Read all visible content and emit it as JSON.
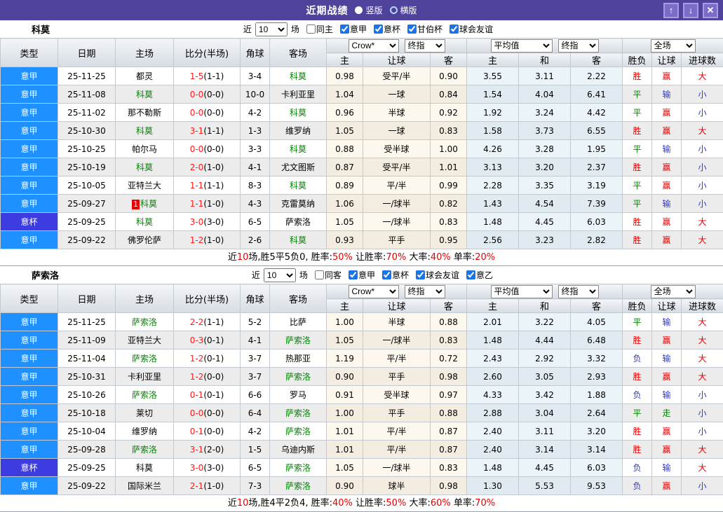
{
  "titlebar": {
    "title": "近期战绩",
    "radios": [
      {
        "label": "竖版",
        "selected": true
      },
      {
        "label": "横版",
        "selected": false
      }
    ],
    "icons": {
      "up": "↑",
      "down": "↓",
      "close": "✕"
    }
  },
  "colors": {
    "title_bg": "#4f429b",
    "league_serie_a_bg": "#1e90ff",
    "league_cup_bg": "#3c3ce0",
    "team_highlight": "#008800",
    "score_red": "#ff1a1a",
    "win_red": "#e60000",
    "lose_blue": "#2b36cc",
    "draw_green": "#008800"
  },
  "table_header": {
    "left": [
      "类型",
      "日期",
      "主场",
      "比分(半场)",
      "角球",
      "客场"
    ],
    "sub": [
      "主",
      "让球",
      "客",
      "主",
      "和",
      "客",
      "胜负",
      "让球",
      "进球数"
    ],
    "dropdowns": {
      "asian_source": "Crow*",
      "asian_time": "终指",
      "euro_source": "平均值",
      "euro_time": "终指",
      "scope": "全场"
    }
  },
  "result_colors": {
    "胜": "red",
    "平": "green",
    "负": "blue",
    "赢": "red",
    "输": "blue",
    "走": "green",
    "大": "red",
    "小": "blue"
  },
  "sections": [
    {
      "team": "科莫",
      "filter": {
        "prefix": "近",
        "count": "10",
        "suffix": "场",
        "same": "同主",
        "same_checked": false,
        "leagues": [
          {
            "label": "意甲",
            "checked": true
          },
          {
            "label": "意杯",
            "checked": true
          },
          {
            "label": "甘伯杯",
            "checked": true
          },
          {
            "label": "球会友谊",
            "checked": true
          }
        ]
      },
      "rows": [
        {
          "lg": "意甲",
          "cup": false,
          "dt": "25-11-25",
          "hm": "都灵",
          "hg": false,
          "bd": "",
          "sc": "1-5",
          "hf": "(1-1)",
          "cn": "3-4",
          "aw": "科莫",
          "ag": true,
          "ah": [
            "0.98",
            "受平/半",
            "0.90"
          ],
          "eu": [
            "3.55",
            "3.11",
            "2.22"
          ],
          "rs": [
            "胜",
            "赢",
            "大"
          ]
        },
        {
          "lg": "意甲",
          "cup": false,
          "dt": "25-11-08",
          "hm": "科莫",
          "hg": true,
          "bd": "",
          "sc": "0-0",
          "hf": "(0-0)",
          "cn": "10-0",
          "aw": "卡利亚里",
          "ag": false,
          "ah": [
            "1.04",
            "一球",
            "0.84"
          ],
          "eu": [
            "1.54",
            "4.04",
            "6.41"
          ],
          "rs": [
            "平",
            "输",
            "小"
          ]
        },
        {
          "lg": "意甲",
          "cup": false,
          "dt": "25-11-02",
          "hm": "那不勒斯",
          "hg": false,
          "bd": "",
          "sc": "0-0",
          "hf": "(0-0)",
          "cn": "4-2",
          "aw": "科莫",
          "ag": true,
          "ah": [
            "0.96",
            "半球",
            "0.92"
          ],
          "eu": [
            "1.92",
            "3.24",
            "4.42"
          ],
          "rs": [
            "平",
            "赢",
            "小"
          ]
        },
        {
          "lg": "意甲",
          "cup": false,
          "dt": "25-10-30",
          "hm": "科莫",
          "hg": true,
          "bd": "",
          "sc": "3-1",
          "hf": "(1-1)",
          "cn": "1-3",
          "aw": "维罗纳",
          "ag": false,
          "ah": [
            "1.05",
            "一球",
            "0.83"
          ],
          "eu": [
            "1.58",
            "3.73",
            "6.55"
          ],
          "rs": [
            "胜",
            "赢",
            "大"
          ]
        },
        {
          "lg": "意甲",
          "cup": false,
          "dt": "25-10-25",
          "hm": "帕尔马",
          "hg": false,
          "bd": "",
          "sc": "0-0",
          "hf": "(0-0)",
          "cn": "3-3",
          "aw": "科莫",
          "ag": true,
          "ah": [
            "0.88",
            "受半球",
            "1.00"
          ],
          "eu": [
            "4.26",
            "3.28",
            "1.95"
          ],
          "rs": [
            "平",
            "输",
            "小"
          ]
        },
        {
          "lg": "意甲",
          "cup": false,
          "dt": "25-10-19",
          "hm": "科莫",
          "hg": true,
          "bd": "",
          "sc": "2-0",
          "hf": "(1-0)",
          "cn": "4-1",
          "aw": "尤文图斯",
          "ag": false,
          "ah": [
            "0.87",
            "受平/半",
            "1.01"
          ],
          "eu": [
            "3.13",
            "3.20",
            "2.37"
          ],
          "rs": [
            "胜",
            "赢",
            "小"
          ]
        },
        {
          "lg": "意甲",
          "cup": false,
          "dt": "25-10-05",
          "hm": "亚特兰大",
          "hg": false,
          "bd": "",
          "sc": "1-1",
          "hf": "(1-1)",
          "cn": "8-3",
          "aw": "科莫",
          "ag": true,
          "ah": [
            "0.89",
            "平/半",
            "0.99"
          ],
          "eu": [
            "2.28",
            "3.35",
            "3.19"
          ],
          "rs": [
            "平",
            "赢",
            "小"
          ]
        },
        {
          "lg": "意甲",
          "cup": false,
          "dt": "25-09-27",
          "hm": "科莫",
          "hg": true,
          "bd": "1",
          "sc": "1-1",
          "hf": "(1-0)",
          "cn": "4-3",
          "aw": "克雷莫纳",
          "ag": false,
          "ah": [
            "1.06",
            "一/球半",
            "0.82"
          ],
          "eu": [
            "1.43",
            "4.54",
            "7.39"
          ],
          "rs": [
            "平",
            "输",
            "小"
          ]
        },
        {
          "lg": "意杯",
          "cup": true,
          "dt": "25-09-25",
          "hm": "科莫",
          "hg": true,
          "bd": "",
          "sc": "3-0",
          "hf": "(3-0)",
          "cn": "6-5",
          "aw": "萨索洛",
          "ag": false,
          "ah": [
            "1.05",
            "一/球半",
            "0.83"
          ],
          "eu": [
            "1.48",
            "4.45",
            "6.03"
          ],
          "rs": [
            "胜",
            "赢",
            "大"
          ]
        },
        {
          "lg": "意甲",
          "cup": false,
          "dt": "25-09-22",
          "hm": "佛罗伦萨",
          "hg": false,
          "bd": "",
          "sc": "1-2",
          "hf": "(1-0)",
          "cn": "2-6",
          "aw": "科莫",
          "ag": true,
          "ah": [
            "0.93",
            "平手",
            "0.95"
          ],
          "eu": [
            "2.56",
            "3.23",
            "2.82"
          ],
          "rs": [
            "胜",
            "赢",
            "大"
          ]
        }
      ],
      "summary": [
        [
          "近",
          0
        ],
        [
          "10",
          1
        ],
        [
          "场,胜5平5负0, 胜率:",
          0
        ],
        [
          "50%",
          1
        ],
        [
          " 让胜率:",
          0
        ],
        [
          "70%",
          1
        ],
        [
          " 大率:",
          0
        ],
        [
          "40%",
          1
        ],
        [
          " 单率:",
          0
        ],
        [
          "20%",
          1
        ]
      ]
    },
    {
      "team": "萨索洛",
      "filter": {
        "prefix": "近",
        "count": "10",
        "suffix": "场",
        "same": "同客",
        "same_checked": false,
        "leagues": [
          {
            "label": "意甲",
            "checked": true
          },
          {
            "label": "意杯",
            "checked": true
          },
          {
            "label": "球会友谊",
            "checked": true
          },
          {
            "label": "意乙",
            "checked": true
          }
        ]
      },
      "rows": [
        {
          "lg": "意甲",
          "cup": false,
          "dt": "25-11-25",
          "hm": "萨索洛",
          "hg": true,
          "bd": "",
          "sc": "2-2",
          "hf": "(1-1)",
          "cn": "5-2",
          "aw": "比萨",
          "ag": false,
          "ah": [
            "1.00",
            "半球",
            "0.88"
          ],
          "eu": [
            "2.01",
            "3.22",
            "4.05"
          ],
          "rs": [
            "平",
            "输",
            "大"
          ]
        },
        {
          "lg": "意甲",
          "cup": false,
          "dt": "25-11-09",
          "hm": "亚特兰大",
          "hg": false,
          "bd": "",
          "sc": "0-3",
          "hf": "(0-1)",
          "cn": "4-1",
          "aw": "萨索洛",
          "ag": true,
          "ah": [
            "1.05",
            "一/球半",
            "0.83"
          ],
          "eu": [
            "1.48",
            "4.44",
            "6.48"
          ],
          "rs": [
            "胜",
            "赢",
            "大"
          ]
        },
        {
          "lg": "意甲",
          "cup": false,
          "dt": "25-11-04",
          "hm": "萨索洛",
          "hg": true,
          "bd": "",
          "sc": "1-2",
          "hf": "(0-1)",
          "cn": "3-7",
          "aw": "热那亚",
          "ag": false,
          "ah": [
            "1.19",
            "平/半",
            "0.72"
          ],
          "eu": [
            "2.43",
            "2.92",
            "3.32"
          ],
          "rs": [
            "负",
            "输",
            "大"
          ]
        },
        {
          "lg": "意甲",
          "cup": false,
          "dt": "25-10-31",
          "hm": "卡利亚里",
          "hg": false,
          "bd": "",
          "sc": "1-2",
          "hf": "(0-0)",
          "cn": "3-7",
          "aw": "萨索洛",
          "ag": true,
          "ah": [
            "0.90",
            "平手",
            "0.98"
          ],
          "eu": [
            "2.60",
            "3.05",
            "2.93"
          ],
          "rs": [
            "胜",
            "赢",
            "大"
          ]
        },
        {
          "lg": "意甲",
          "cup": false,
          "dt": "25-10-26",
          "hm": "萨索洛",
          "hg": true,
          "bd": "",
          "sc": "0-1",
          "hf": "(0-1)",
          "cn": "6-6",
          "aw": "罗马",
          "ag": false,
          "ah": [
            "0.91",
            "受半球",
            "0.97"
          ],
          "eu": [
            "4.33",
            "3.42",
            "1.88"
          ],
          "rs": [
            "负",
            "输",
            "小"
          ]
        },
        {
          "lg": "意甲",
          "cup": false,
          "dt": "25-10-18",
          "hm": "莱切",
          "hg": false,
          "bd": "",
          "sc": "0-0",
          "hf": "(0-0)",
          "cn": "6-4",
          "aw": "萨索洛",
          "ag": true,
          "ah": [
            "1.00",
            "平手",
            "0.88"
          ],
          "eu": [
            "2.88",
            "3.04",
            "2.64"
          ],
          "rs": [
            "平",
            "走",
            "小"
          ]
        },
        {
          "lg": "意甲",
          "cup": false,
          "dt": "25-10-04",
          "hm": "维罗纳",
          "hg": false,
          "bd": "",
          "sc": "0-1",
          "hf": "(0-0)",
          "cn": "4-2",
          "aw": "萨索洛",
          "ag": true,
          "ah": [
            "1.01",
            "平/半",
            "0.87"
          ],
          "eu": [
            "2.40",
            "3.11",
            "3.20"
          ],
          "rs": [
            "胜",
            "赢",
            "小"
          ]
        },
        {
          "lg": "意甲",
          "cup": false,
          "dt": "25-09-28",
          "hm": "萨索洛",
          "hg": true,
          "bd": "",
          "sc": "3-1",
          "hf": "(2-0)",
          "cn": "1-5",
          "aw": "乌迪内斯",
          "ag": false,
          "ah": [
            "1.01",
            "平/半",
            "0.87"
          ],
          "eu": [
            "2.40",
            "3.14",
            "3.14"
          ],
          "rs": [
            "胜",
            "赢",
            "大"
          ]
        },
        {
          "lg": "意杯",
          "cup": true,
          "dt": "25-09-25",
          "hm": "科莫",
          "hg": false,
          "bd": "",
          "sc": "3-0",
          "hf": "(3-0)",
          "cn": "6-5",
          "aw": "萨索洛",
          "ag": true,
          "ah": [
            "1.05",
            "一/球半",
            "0.83"
          ],
          "eu": [
            "1.48",
            "4.45",
            "6.03"
          ],
          "rs": [
            "负",
            "输",
            "大"
          ]
        },
        {
          "lg": "意甲",
          "cup": false,
          "dt": "25-09-22",
          "hm": "国际米兰",
          "hg": false,
          "bd": "",
          "sc": "2-1",
          "hf": "(1-0)",
          "cn": "7-3",
          "aw": "萨索洛",
          "ag": true,
          "ah": [
            "0.90",
            "球半",
            "0.98"
          ],
          "eu": [
            "1.30",
            "5.53",
            "9.53"
          ],
          "rs": [
            "负",
            "赢",
            "小"
          ]
        }
      ],
      "summary": [
        [
          "近",
          0
        ],
        [
          "10",
          1
        ],
        [
          "场,胜4平2负4, 胜率:",
          0
        ],
        [
          "40%",
          1
        ],
        [
          " 让胜率:",
          0
        ],
        [
          "50%",
          1
        ],
        [
          " 大率:",
          0
        ],
        [
          "60%",
          1
        ],
        [
          " 单率:",
          0
        ],
        [
          "70%",
          1
        ]
      ]
    }
  ]
}
